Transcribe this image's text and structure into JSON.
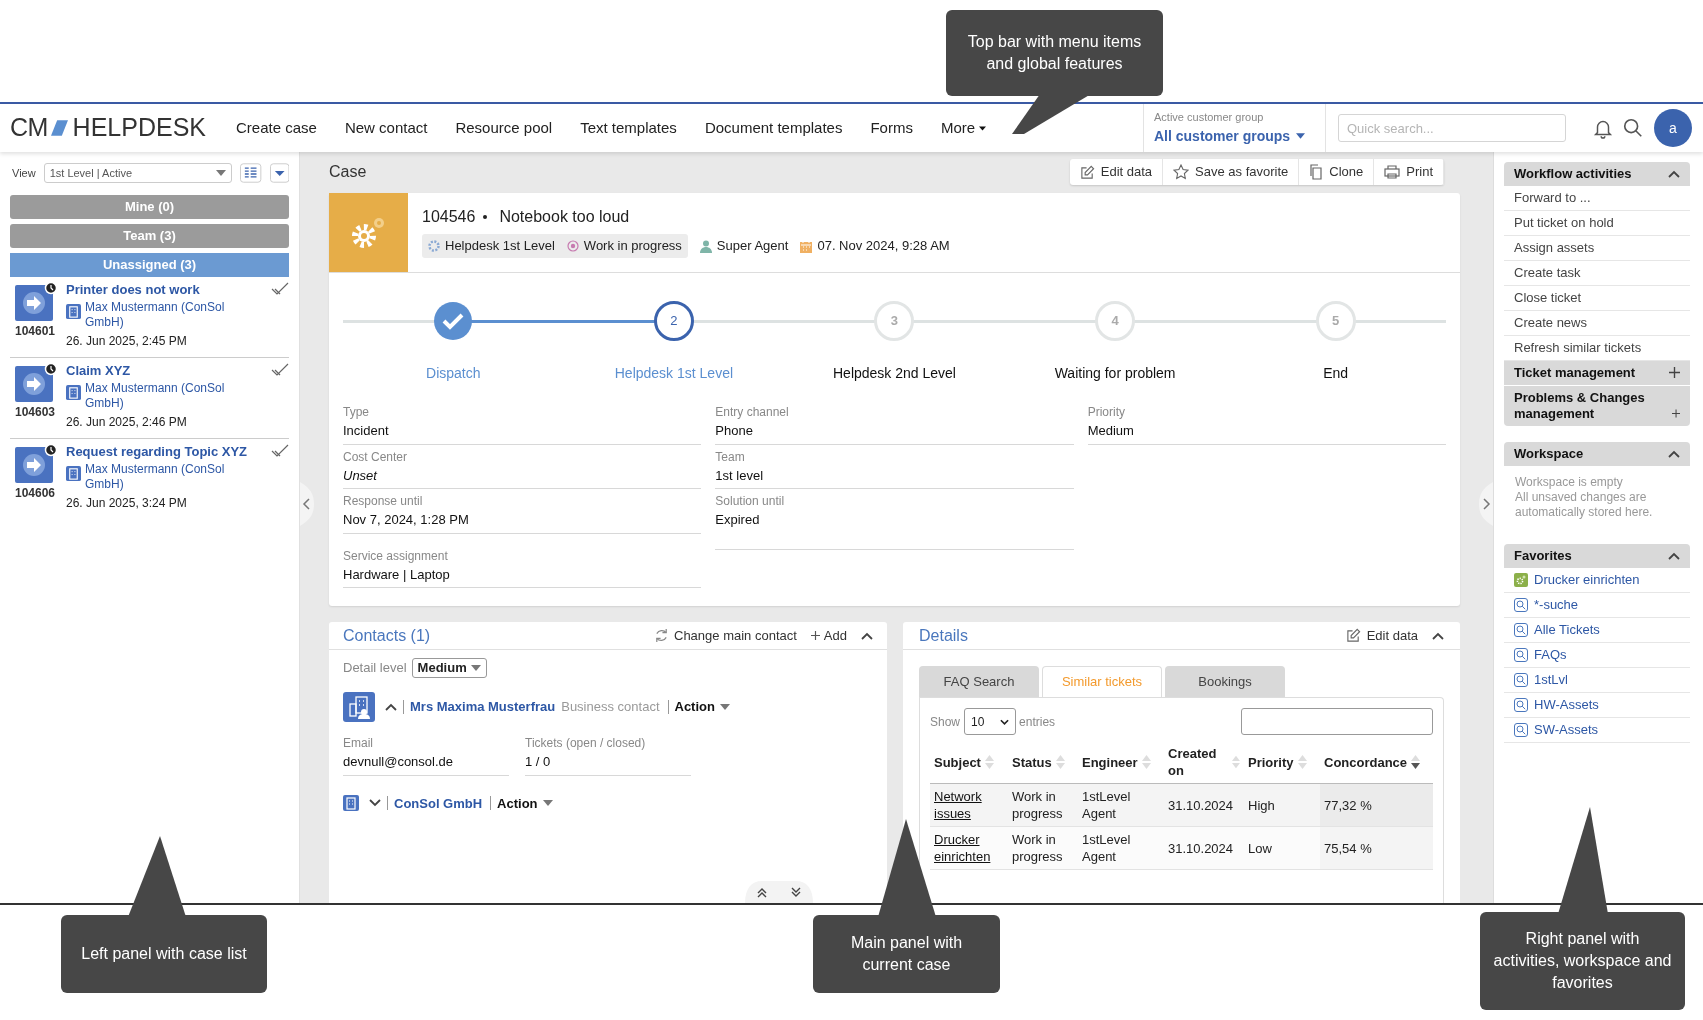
{
  "callouts": [
    {
      "text": "Top bar with menu items and global features"
    },
    {
      "text": "Left panel with case list"
    },
    {
      "text": "Main panel with current case"
    },
    {
      "text": "Right panel with activities, workspace and favorites"
    }
  ],
  "top_bar": {
    "logo": {
      "mark": "CM",
      "name": "HELPDESK"
    },
    "menu": [
      "Create case",
      "New contact",
      "Resource pool",
      "Text templates",
      "Document templates",
      "Forms"
    ],
    "more": "More",
    "customer_group": {
      "label": "Active customer group",
      "value": "All customer groups"
    },
    "search": {
      "placeholder": "Quick search..."
    },
    "avatar": "a"
  },
  "left_panel": {
    "view_label": "View",
    "view_value": "1st Level | Active",
    "groups": [
      {
        "label": "Mine (0)",
        "selected": false
      },
      {
        "label": "Team (3)",
        "selected": false
      },
      {
        "label": "Unassigned (3)",
        "selected": true
      }
    ],
    "cases": [
      {
        "id": "104601",
        "title": "Printer does not work",
        "contact": "Max Mustermann (ConSol GmbH)",
        "date": "26. Jun 2025, 2:45 PM"
      },
      {
        "id": "104603",
        "title": "Claim XYZ",
        "contact": "Max Mustermann (ConSol GmbH)",
        "date": "26. Jun 2025, 2:46 PM"
      },
      {
        "id": "104606",
        "title": "Request regarding Topic XYZ",
        "contact": "Max Mustermann (ConSol GmbH)",
        "date": "26. Jun 2025, 3:24 PM"
      }
    ]
  },
  "case": {
    "heading": "Case",
    "actions": [
      "Edit data",
      "Save as favorite",
      "Clone",
      "Print"
    ],
    "number": "104546",
    "title": "Notebook too loud",
    "queue": "Helpdesk 1st Level",
    "status": "Work in progress",
    "agent": "Super Agent",
    "date": "07. Nov 2024, 9:28 AM",
    "steps": [
      {
        "label": "Dispatch",
        "done": true,
        "current": false
      },
      {
        "number": "2",
        "label": "Helpdesk 1st Level",
        "done": false,
        "current": true
      },
      {
        "number": "3",
        "label": "Helpdesk 2nd Level",
        "done": false,
        "current": false
      },
      {
        "number": "4",
        "label": "Waiting for problem",
        "done": false,
        "current": false
      },
      {
        "number": "5",
        "label": "End",
        "done": false,
        "current": false
      }
    ],
    "fields": [
      [
        {
          "label": "Type",
          "value": "Incident",
          "unset": false
        },
        {
          "label": "Cost Center",
          "value": "Unset",
          "unset": true
        },
        {
          "label": "Response until",
          "value": "Nov 7, 2024, 1:28 PM",
          "unset": false
        },
        {
          "label": "Service assignment",
          "value": "Hardware | Laptop",
          "unset": false
        }
      ],
      [
        {
          "label": "Entry channel",
          "value": "Phone",
          "unset": false
        },
        {
          "label": "Team",
          "value": "1st level",
          "unset": false
        },
        {
          "label": "Solution until",
          "value": "Expired",
          "unset": false
        }
      ],
      [
        {
          "label": "Priority",
          "value": "Medium",
          "unset": false
        }
      ]
    ]
  },
  "contacts": {
    "title": "Contacts (1)",
    "change": "Change main contact",
    "add": "Add",
    "detail_label": "Detail level",
    "detail_value": "Medium",
    "entries": [
      {
        "kind": "person",
        "expanded": true,
        "name": "Mrs Maxima Musterfrau",
        "role": "Business contact",
        "action": "Action",
        "fields": [
          {
            "label": "Email",
            "value": "devnull@consol.de"
          },
          {
            "label": "Tickets (open / closed)",
            "value": "1 / 0"
          }
        ]
      },
      {
        "kind": "company",
        "expanded": false,
        "name": "ConSol GmbH",
        "action": "Action"
      }
    ]
  },
  "details": {
    "title": "Details",
    "edit": "Edit data",
    "tabs": [
      {
        "label": "FAQ Search",
        "selected": false
      },
      {
        "label": "Similar tickets",
        "selected": true
      },
      {
        "label": "Bookings",
        "selected": false
      }
    ],
    "show": "Show",
    "page_size": "10",
    "entries": "entries",
    "columns": [
      {
        "label": "Subject",
        "sorted": false
      },
      {
        "label": "Status",
        "sorted": false
      },
      {
        "label": "Engineer",
        "sorted": false
      },
      {
        "label": "Created on",
        "sorted": false
      },
      {
        "label": "Priority",
        "sorted": false
      },
      {
        "label": "Concordance",
        "sorted": true
      }
    ],
    "rows": [
      [
        "Network issues",
        "Work in progress",
        "1stLevel Agent",
        "31.10.2024",
        "High",
        "77,32 %"
      ],
      [
        "Drucker einrichten",
        "Work in progress",
        "1stLevel Agent",
        "31.10.2024",
        "Low",
        "75,54 %"
      ]
    ]
  },
  "right_panel": {
    "activities": [
      {
        "title": "Workflow activities",
        "expanded": true,
        "items": [
          "Forward to ...",
          "Put ticket on hold",
          "Assign assets",
          "Create task",
          "Close ticket",
          "Create news",
          "Refresh similar tickets"
        ]
      },
      {
        "title": "Ticket management",
        "expanded": false
      },
      {
        "title": "Problems & Changes management",
        "expanded": false
      }
    ],
    "workspace": {
      "title": "Workspace",
      "expanded": true,
      "lines": [
        "Workspace is empty",
        "All unsaved changes are automatically stored here."
      ]
    },
    "favorites": {
      "title": "Favorites",
      "expanded": true,
      "items": [
        {
          "label": "Drucker einrichten",
          "kind": "ticket"
        },
        {
          "label": "*-suche",
          "kind": "search"
        },
        {
          "label": "Alle Tickets",
          "kind": "search"
        },
        {
          "label": "FAQs",
          "kind": "search"
        },
        {
          "label": "1stLvl",
          "kind": "search"
        },
        {
          "label": "HW-Assets",
          "kind": "search"
        },
        {
          "label": "SW-Assets",
          "kind": "search"
        }
      ]
    }
  }
}
